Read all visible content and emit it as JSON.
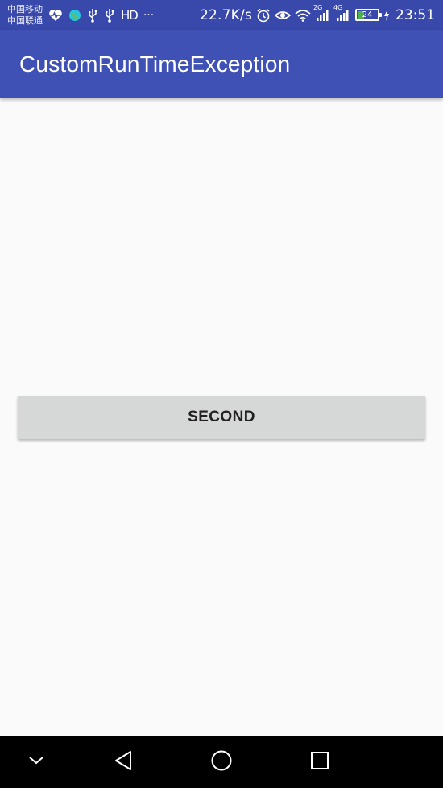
{
  "status_bar": {
    "carrier_1": "中国移动",
    "carrier_2": "中国联通",
    "more": "···",
    "hd_label": "HD",
    "network_speed": "22.7K/s",
    "signal_1_type": "2G",
    "signal_2_type": "4G",
    "battery_level": "24",
    "time": "23:51",
    "icons": [
      "heart-rate-icon",
      "globe-icon",
      "usb-icon",
      "usb-icon",
      "hd-icon",
      "more-icon",
      "alarm-icon",
      "eye-icon",
      "wifi-icon",
      "signal-icon",
      "signal-icon",
      "battery-icon",
      "charging-icon"
    ],
    "background_color": "#3949ab"
  },
  "app_bar": {
    "title": "CustomRunTimeException",
    "background_color": "#3f51b5"
  },
  "main": {
    "second_button_label": "SECOND"
  },
  "nav_bar": {
    "items": [
      "collapse-icon",
      "back-icon",
      "home-icon",
      "recents-icon"
    ]
  }
}
